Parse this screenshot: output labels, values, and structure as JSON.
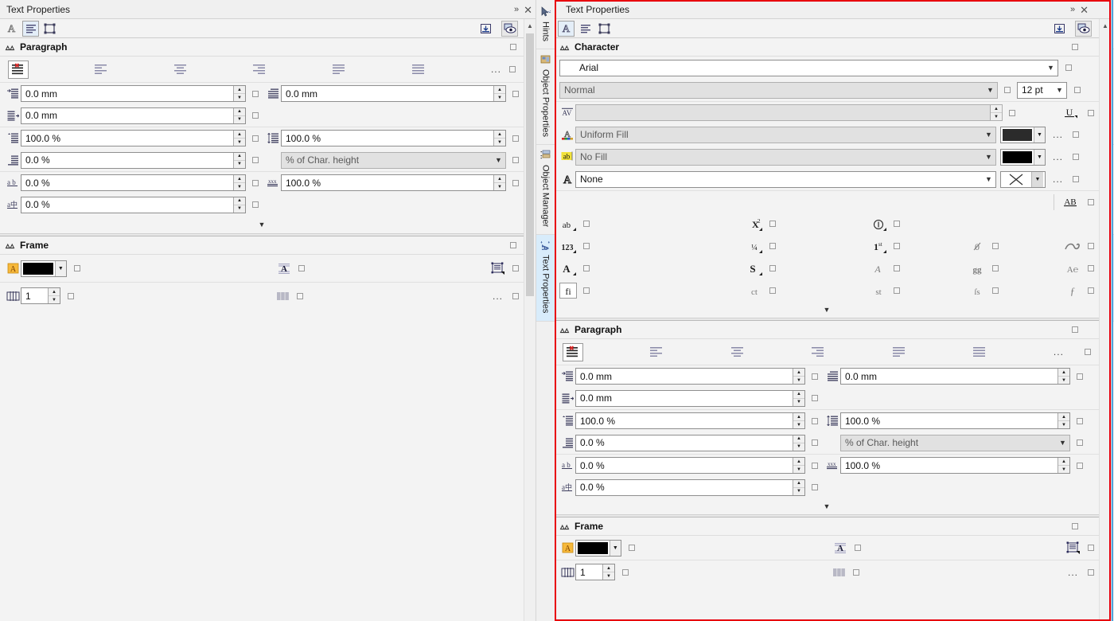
{
  "panels": [
    {
      "id": "left",
      "title": "Text Properties",
      "active": false,
      "toolbar": {
        "tabs": [
          {
            "name": "character-tab",
            "icon": "A-outline-icon",
            "selected": false
          },
          {
            "name": "paragraph-tab",
            "icon": "paragraph-lines-icon",
            "selected": true
          },
          {
            "name": "frame-tab",
            "icon": "frame-icon",
            "selected": false
          }
        ],
        "right": [
          {
            "name": "import-icon",
            "label": ""
          },
          {
            "name": "preview-eye-icon",
            "label": "",
            "selected": true
          }
        ]
      },
      "sections": {
        "paragraph": {
          "label": "Paragraph",
          "align_buttons": [
            {
              "name": "align-none",
              "selected": true
            },
            {
              "name": "align-left",
              "selected": false
            },
            {
              "name": "align-center",
              "selected": false
            },
            {
              "name": "align-right",
              "selected": false
            },
            {
              "name": "align-full-justify",
              "selected": false
            },
            {
              "name": "align-force-justify",
              "selected": false
            }
          ],
          "overflow_label": "...",
          "fields": [
            {
              "icon": "first-line-indent-icon",
              "value": "0.0 mm",
              "type": "spin",
              "right_icon": "right-indent-icon",
              "right_value": "0.0 mm",
              "right_type": "spin"
            },
            {
              "icon": "left-indent-icon",
              "value": "0.0 mm",
              "type": "spin",
              "right_icon": "",
              "right_value": "",
              "right_type": "none"
            },
            {
              "icon": "space-before-icon",
              "value": "100.0 %",
              "type": "spin",
              "right_icon": "line-spacing-icon",
              "right_value": "100.0 %",
              "right_type": "spin"
            },
            {
              "icon": "space-after-icon",
              "value": "0.0 %",
              "type": "spin",
              "right_icon": "",
              "right_value": "% of Char. height",
              "right_type": "select"
            },
            {
              "icon": "char-spacing-icon",
              "value": "0.0 %",
              "type": "spin",
              "right_icon": "language-spacing-icon",
              "right_value": "100.0 %",
              "right_type": "spin"
            },
            {
              "icon": "word-spacing-icon",
              "value": "0.0 %",
              "type": "spin",
              "right_icon": "",
              "right_value": "",
              "right_type": "none"
            }
          ]
        },
        "frame": {
          "label": "Frame",
          "fill_color": "#000000",
          "fill_icon": "frame-fill-icon",
          "text-wrap_icon": "text-wrap-icon",
          "frame-flow_icon": "frame-flow-icon",
          "columns_icon": "columns-icon",
          "columns_value": "1",
          "columns_settings_icon": "column-settings-icon",
          "overflow_label": "..."
        }
      }
    },
    {
      "id": "right",
      "title": "Text Properties",
      "active": true,
      "toolbar": {
        "tabs": [
          {
            "name": "character-tab",
            "icon": "A-outline-icon",
            "selected": true
          },
          {
            "name": "paragraph-tab",
            "icon": "paragraph-lines-icon",
            "selected": false
          },
          {
            "name": "frame-tab",
            "icon": "frame-icon",
            "selected": false
          }
        ]
      },
      "sections": {
        "character": {
          "label": "Character",
          "font_family": "Arial",
          "font_style": "Normal",
          "font_size": "12 pt",
          "kerning_value": "",
          "underline_icon": "underline-icon",
          "fill_type": "Uniform Fill",
          "fill_color": "#2b2b2b",
          "background_type": "No Fill",
          "background_color": "#000000",
          "outline_type": "None",
          "outline_color": "none",
          "row_ellipsis": "...",
          "ot_features": [
            [
              {
                "glyph": "ab",
                "name": "lowercase-icon",
                "style": "dark",
                "arrow": true
              },
              {
                "glyph": "X²",
                "name": "superscript-icon",
                "style": "dark",
                "arrow": true
              },
              {
                "glyph": "①",
                "name": "circled-number-icon",
                "style": "dark",
                "arrow": true
              },
              {
                "glyph": "",
                "name": "",
                "style": "",
                "arrow": false
              },
              {
                "glyph": "AB",
                "name": "all-caps-underline-icon",
                "style": "dark",
                "arrow": false
              }
            ],
            [
              {
                "glyph": "123",
                "name": "numeral-style-icon",
                "style": "dark",
                "arrow": true
              },
              {
                "glyph": "¼",
                "name": "fractions-icon",
                "style": "dark",
                "arrow": true
              },
              {
                "glyph": "1ˢᵗ",
                "name": "ordinals-icon",
                "style": "dark",
                "arrow": true
              },
              {
                "glyph": "0",
                "name": "slashed-zero-icon",
                "style": "grey",
                "arrow": false
              },
              {
                "glyph": "",
                "name": "swash-icon",
                "style": "grey",
                "arrow": false
              }
            ],
            [
              {
                "glyph": "A",
                "name": "capitals-icon",
                "style": "dark",
                "arrow": true
              },
              {
                "glyph": "S",
                "name": "stylistic-set-icon",
                "style": "dark",
                "arrow": true
              },
              {
                "glyph": "𝒜",
                "name": "italic-alternate-icon",
                "style": "grey",
                "arrow": false
              },
              {
                "glyph": "gg",
                "name": "glyph-alternates-icon",
                "style": "grey",
                "arrow": false
              },
              {
                "glyph": "A℮",
                "name": "ornaments-icon",
                "style": "grey",
                "arrow": false
              }
            ],
            [
              {
                "glyph": "fi",
                "name": "standard-ligature-icon",
                "style": "boxed",
                "arrow": false
              },
              {
                "glyph": "ct",
                "name": "discretionary-ligature-icon",
                "style": "grey",
                "arrow": false
              },
              {
                "glyph": "st",
                "name": "historical-ligature-icon",
                "style": "grey",
                "arrow": false
              },
              {
                "glyph": "ſs",
                "name": "historical-forms-icon",
                "style": "grey",
                "arrow": false
              },
              {
                "glyph": "ƒ",
                "name": "contextual-alternates-icon",
                "style": "grey",
                "arrow": false
              }
            ]
          ]
        },
        "paragraph": {
          "label": "Paragraph",
          "align_buttons": [
            {
              "name": "align-none",
              "selected": true
            },
            {
              "name": "align-left",
              "selected": false
            },
            {
              "name": "align-center",
              "selected": false
            },
            {
              "name": "align-right",
              "selected": false
            },
            {
              "name": "align-full-justify",
              "selected": false
            },
            {
              "name": "align-force-justify",
              "selected": false
            }
          ],
          "overflow_label": "...",
          "fields": [
            {
              "icon": "first-line-indent-icon",
              "value": "0.0 mm",
              "type": "spin",
              "right_icon": "right-indent-icon",
              "right_value": "0.0 mm",
              "right_type": "spin"
            },
            {
              "icon": "left-indent-icon",
              "value": "0.0 mm",
              "type": "spin",
              "right_icon": "",
              "right_value": "",
              "right_type": "none"
            },
            {
              "icon": "space-before-icon",
              "value": "100.0 %",
              "type": "spin",
              "right_icon": "line-spacing-icon",
              "right_value": "100.0 %",
              "right_type": "spin"
            },
            {
              "icon": "space-after-icon",
              "value": "0.0 %",
              "type": "spin",
              "right_icon": "",
              "right_value": "% of Char. height",
              "right_type": "select"
            },
            {
              "icon": "char-spacing-icon",
              "value": "0.0 %",
              "type": "spin",
              "right_icon": "language-spacing-icon",
              "right_value": "100.0 %",
              "right_type": "spin"
            },
            {
              "icon": "word-spacing-icon",
              "value": "0.0 %",
              "type": "spin",
              "right_icon": "",
              "right_value": "",
              "right_type": "none"
            }
          ]
        },
        "frame": {
          "label": "Frame",
          "fill_color": "#000000",
          "columns_value": "1",
          "overflow_label": "..."
        }
      }
    }
  ],
  "rail": {
    "tabs": [
      {
        "label": "Hints",
        "icon": "cursor-question-icon",
        "active": false
      },
      {
        "label": "Object Properties",
        "icon": "object-properties-icon",
        "active": false
      },
      {
        "label": "Object Manager",
        "icon": "object-manager-icon",
        "active": false
      },
      {
        "label": "Text Properties",
        "icon": "text-properties-icon",
        "active": true
      }
    ],
    "add_label": "+"
  }
}
